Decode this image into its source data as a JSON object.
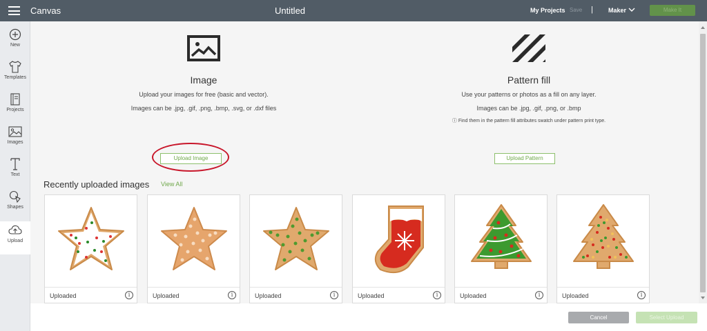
{
  "topbar": {
    "app_title": "Canvas",
    "doc_title": "Untitled",
    "my_projects": "My Projects",
    "save": "Save",
    "divider": "|",
    "machine": "Maker",
    "make_it": "Make It"
  },
  "sidebar": {
    "items": [
      {
        "label": "New",
        "icon": "plus-circle-icon"
      },
      {
        "label": "Templates",
        "icon": "tshirt-icon"
      },
      {
        "label": "Projects",
        "icon": "book-icon"
      },
      {
        "label": "Images",
        "icon": "image-icon"
      },
      {
        "label": "Text",
        "icon": "text-t-icon"
      },
      {
        "label": "Shapes",
        "icon": "shapes-icon"
      },
      {
        "label": "Upload",
        "icon": "cloud-upload-icon"
      }
    ]
  },
  "image_section": {
    "title": "Image",
    "subtitle": "Upload your images for free (basic and vector).",
    "formats": "Images can be .jpg, .gif, .png, .bmp, .svg, or .dxf files",
    "button": "Upload Image"
  },
  "pattern_section": {
    "title": "Pattern fill",
    "subtitle": "Use your patterns or photos as a fill on any layer.",
    "formats": "Images can be .jpg, .gif, .png, or .bmp",
    "note": "ⓘ Find them in the pattern fill attributes swatch under pattern print type.",
    "button": "Upload Pattern"
  },
  "recent": {
    "title": "Recently uploaded images",
    "view_all": "View All",
    "cards": [
      {
        "label": "Uploaded",
        "info": "i"
      },
      {
        "label": "Uploaded",
        "info": "i"
      },
      {
        "label": "Uploaded",
        "info": "i"
      },
      {
        "label": "Uploaded",
        "info": "i"
      },
      {
        "label": "Uploaded",
        "info": "i"
      },
      {
        "label": "Uploaded",
        "info": "i"
      }
    ]
  },
  "footer": {
    "cancel": "Cancel",
    "select": "Select Upload"
  },
  "colors": {
    "topbar": "#515c66",
    "accent_green": "#62924a",
    "highlight_red": "#c8162a"
  }
}
